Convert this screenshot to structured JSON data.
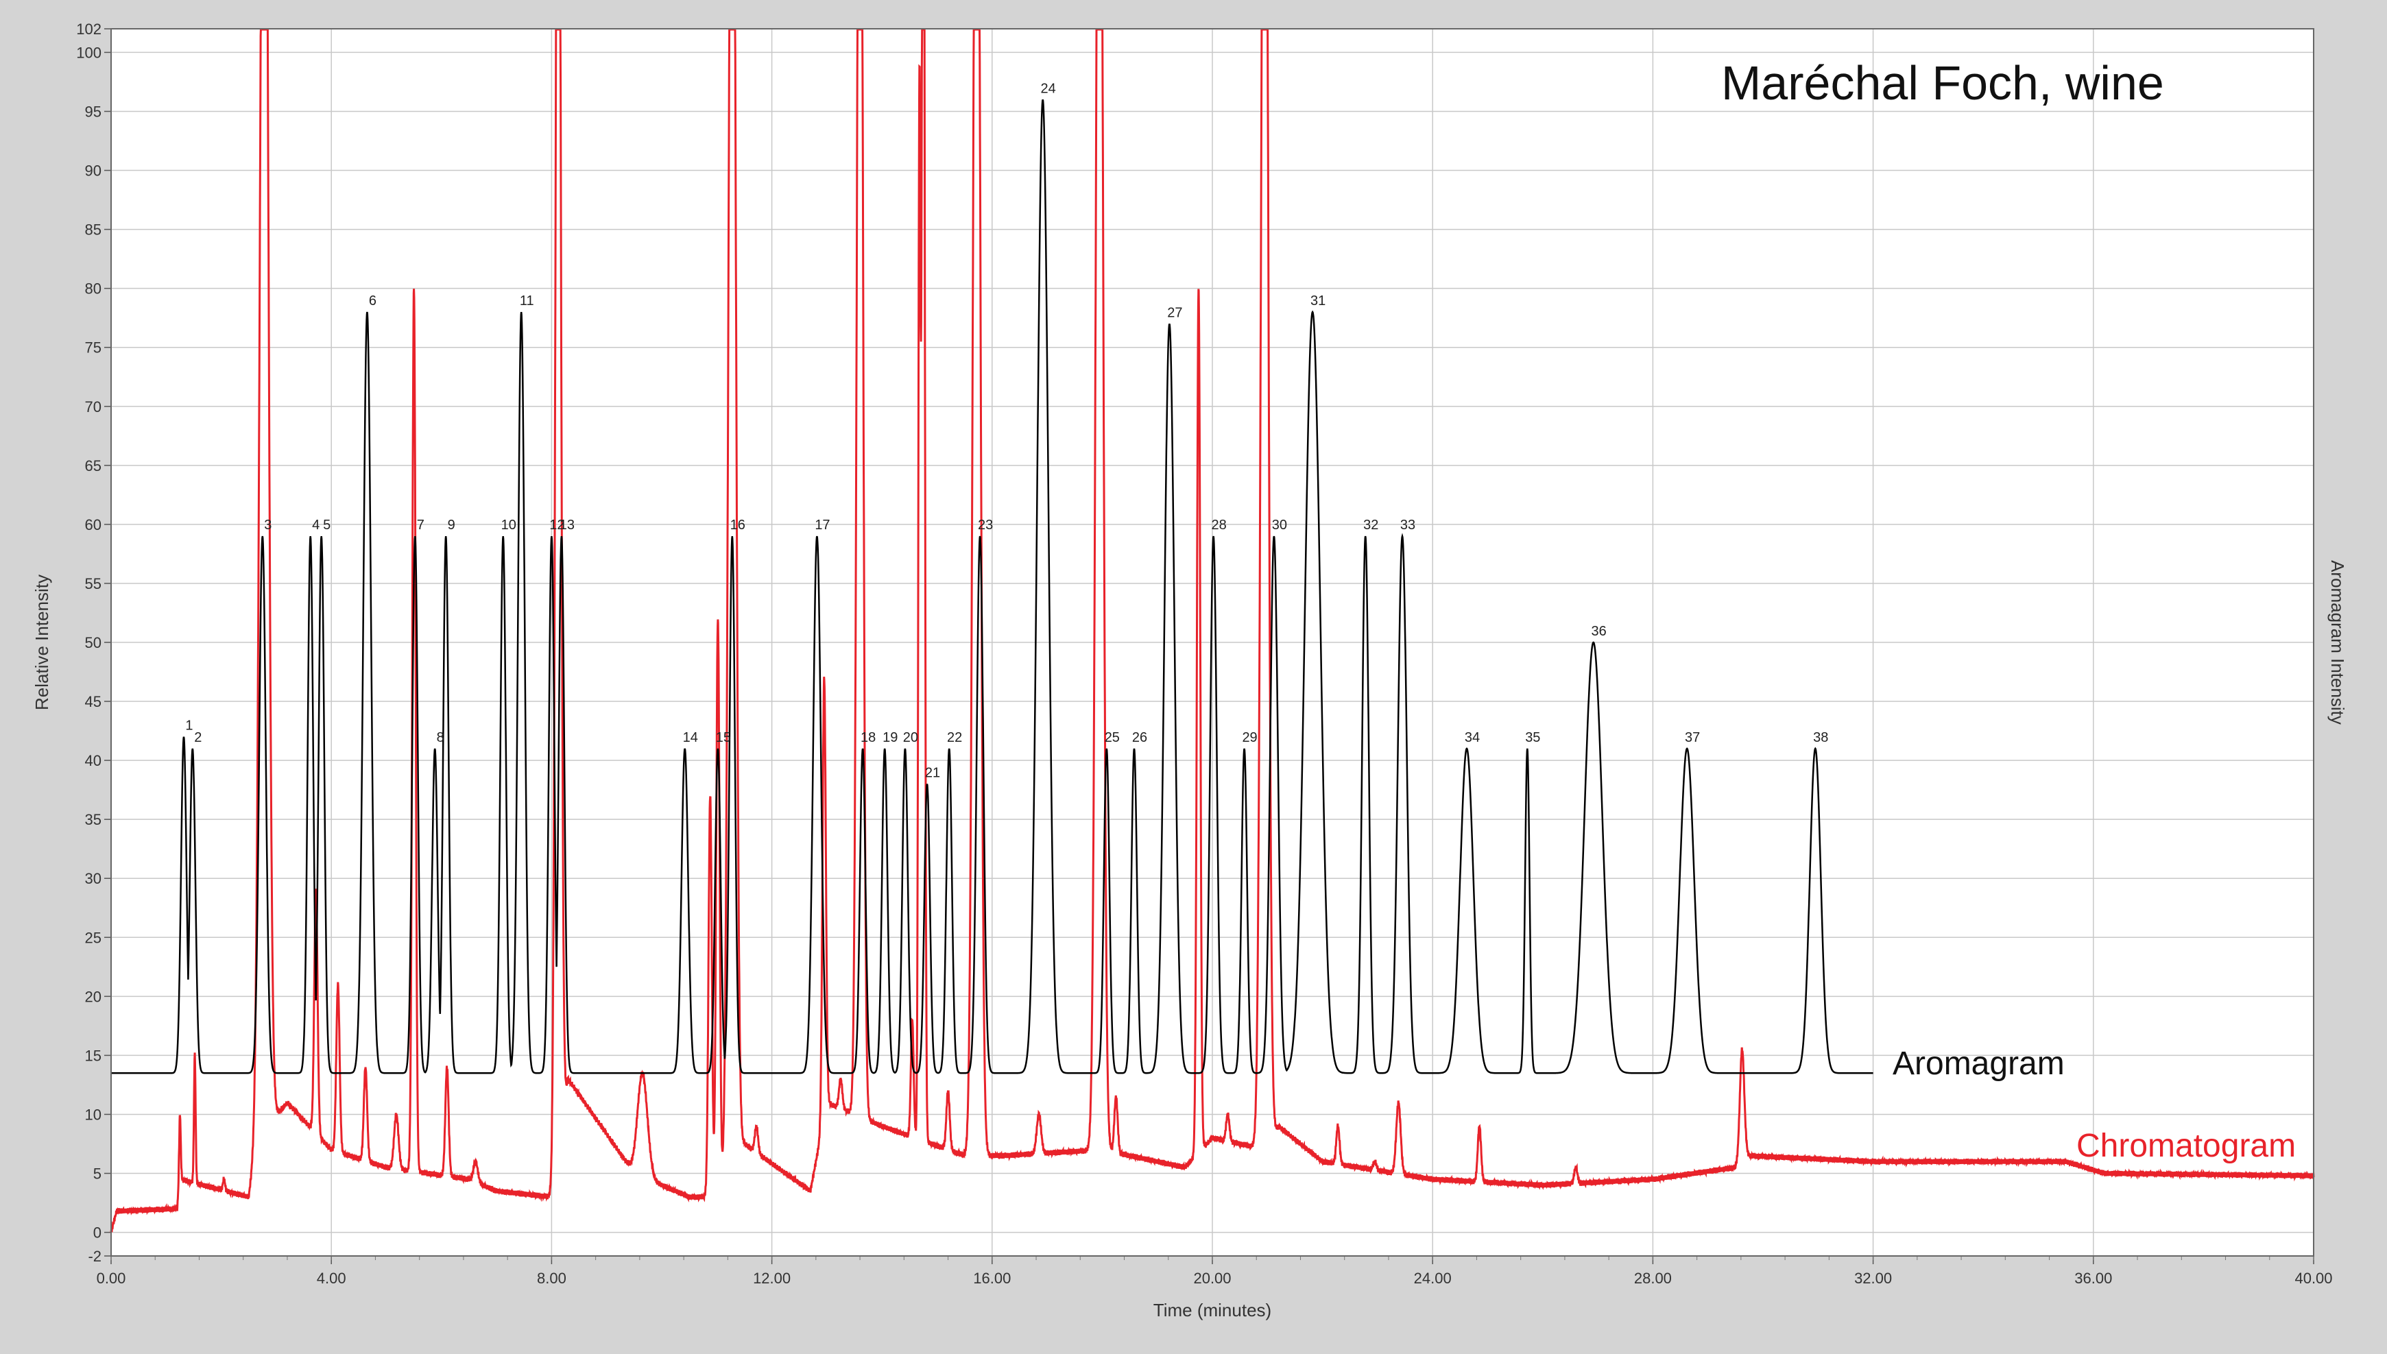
{
  "chart_data": {
    "type": "line",
    "title": "Maréchal Foch, wine",
    "xlabel": "Time (minutes)",
    "ylabel": "Relative Intensity",
    "y2label": "Aromagram Intensity",
    "xlim": [
      0,
      40
    ],
    "ylim": [
      -2,
      102
    ],
    "x_ticks": [
      "0.00",
      "4.00",
      "8.00",
      "12.00",
      "16.00",
      "20.00",
      "24.00",
      "28.00",
      "32.00",
      "36.00",
      "40.00"
    ],
    "y_ticks": [
      "-2",
      "0",
      "5",
      "10",
      "15",
      "20",
      "25",
      "30",
      "35",
      "40",
      "45",
      "50",
      "55",
      "60",
      "65",
      "70",
      "75",
      "80",
      "85",
      "90",
      "95",
      "100",
      "102"
    ],
    "grid": true,
    "colors": {
      "aromagram": "#000000",
      "chromatogram": "#e8222a",
      "plot_bg": "#ffffff",
      "frame_bg": "#d4d4d4",
      "grid": "#c8c8c8"
    },
    "series": [
      {
        "name": "Aromagram",
        "baseline": 13.5,
        "end_x": 32.0,
        "peaks": [
          {
            "label": "1",
            "x": 1.32,
            "y": 42,
            "w": 0.05
          },
          {
            "label": "2",
            "x": 1.48,
            "y": 41,
            "w": 0.05
          },
          {
            "label": "3",
            "x": 2.75,
            "y": 59,
            "w": 0.06
          },
          {
            "label": "4",
            "x": 3.62,
            "y": 59,
            "w": 0.05
          },
          {
            "label": "5",
            "x": 3.82,
            "y": 59,
            "w": 0.05
          },
          {
            "label": "6",
            "x": 4.65,
            "y": 78,
            "w": 0.07
          },
          {
            "label": "7",
            "x": 5.52,
            "y": 59,
            "w": 0.05
          },
          {
            "label": "8",
            "x": 5.88,
            "y": 41,
            "w": 0.05
          },
          {
            "label": "9",
            "x": 6.08,
            "y": 59,
            "w": 0.05
          },
          {
            "label": "10",
            "x": 7.12,
            "y": 59,
            "w": 0.05
          },
          {
            "label": "11",
            "x": 7.45,
            "y": 78,
            "w": 0.06
          },
          {
            "label": "12",
            "x": 8.0,
            "y": 59,
            "w": 0.05
          },
          {
            "label": "13",
            "x": 8.18,
            "y": 59,
            "w": 0.05
          },
          {
            "label": "14",
            "x": 10.42,
            "y": 41,
            "w": 0.06
          },
          {
            "label": "15",
            "x": 11.02,
            "y": 41,
            "w": 0.05
          },
          {
            "label": "16",
            "x": 11.28,
            "y": 59,
            "w": 0.05
          },
          {
            "label": "17",
            "x": 12.82,
            "y": 59,
            "w": 0.07
          },
          {
            "label": "18",
            "x": 13.65,
            "y": 41,
            "w": 0.05
          },
          {
            "label": "19",
            "x": 14.05,
            "y": 41,
            "w": 0.05
          },
          {
            "label": "20",
            "x": 14.42,
            "y": 41,
            "w": 0.05
          },
          {
            "label": "21",
            "x": 14.82,
            "y": 38,
            "w": 0.05
          },
          {
            "label": "22",
            "x": 15.22,
            "y": 41,
            "w": 0.05
          },
          {
            "label": "23",
            "x": 15.78,
            "y": 59,
            "w": 0.06
          },
          {
            "label": "24",
            "x": 16.92,
            "y": 96,
            "w": 0.1
          },
          {
            "label": "25",
            "x": 18.08,
            "y": 41,
            "w": 0.05
          },
          {
            "label": "26",
            "x": 18.58,
            "y": 41,
            "w": 0.05
          },
          {
            "label": "27",
            "x": 19.22,
            "y": 77,
            "w": 0.09
          },
          {
            "label": "28",
            "x": 20.02,
            "y": 59,
            "w": 0.06
          },
          {
            "label": "29",
            "x": 20.58,
            "y": 41,
            "w": 0.05
          },
          {
            "label": "30",
            "x": 21.12,
            "y": 59,
            "w": 0.07
          },
          {
            "label": "31",
            "x": 21.82,
            "y": 78,
            "w": 0.14
          },
          {
            "label": "32",
            "x": 22.78,
            "y": 59,
            "w": 0.06
          },
          {
            "label": "33",
            "x": 23.45,
            "y": 59,
            "w": 0.08
          },
          {
            "label": "34",
            "x": 24.62,
            "y": 41,
            "w": 0.12
          },
          {
            "label": "35",
            "x": 25.72,
            "y": 41,
            "w": 0.04
          },
          {
            "label": "36",
            "x": 26.92,
            "y": 50,
            "w": 0.16
          },
          {
            "label": "37",
            "x": 28.62,
            "y": 41,
            "w": 0.13
          },
          {
            "label": "38",
            "x": 30.95,
            "y": 41,
            "w": 0.1
          }
        ]
      },
      {
        "name": "Chromatogram",
        "baseline_profile": [
          [
            0.0,
            0.0
          ],
          [
            0.1,
            1.8
          ],
          [
            1.2,
            2.0
          ],
          [
            1.25,
            4.5
          ],
          [
            2.5,
            3.0
          ],
          [
            2.65,
            8.0
          ],
          [
            3.2,
            11.0
          ],
          [
            4.0,
            7.0
          ],
          [
            5.0,
            5.5
          ],
          [
            6.5,
            4.5
          ],
          [
            7.0,
            3.5
          ],
          [
            8.0,
            3.0
          ],
          [
            8.3,
            13.0
          ],
          [
            9.5,
            5.0
          ],
          [
            10.5,
            3.0
          ],
          [
            11.0,
            3.0
          ],
          [
            11.5,
            7.5
          ],
          [
            12.7,
            3.5
          ],
          [
            13.0,
            11.0
          ],
          [
            14.0,
            9.0
          ],
          [
            15.5,
            6.5
          ],
          [
            16.2,
            6.5
          ],
          [
            18.0,
            7.0
          ],
          [
            19.5,
            5.5
          ],
          [
            20.0,
            8.0
          ],
          [
            21.0,
            7.0
          ],
          [
            21.2,
            9.0
          ],
          [
            22.0,
            6.0
          ],
          [
            24.0,
            4.5
          ],
          [
            26.0,
            4.0
          ],
          [
            28.0,
            4.5
          ],
          [
            29.5,
            5.5
          ],
          [
            29.7,
            6.5
          ],
          [
            32.0,
            6.0
          ],
          [
            35.5,
            6.0
          ],
          [
            36.2,
            5.0
          ],
          [
            40.0,
            4.8
          ]
        ],
        "peaks": [
          {
            "x": 1.25,
            "y": 10,
            "w": 0.015
          },
          {
            "x": 1.52,
            "y": 15,
            "w": 0.015
          },
          {
            "x": 2.05,
            "y": 4.5,
            "w": 0.02
          },
          {
            "x": 2.78,
            "y": 150,
            "w": 0.07
          },
          {
            "x": 3.72,
            "y": 29,
            "w": 0.03
          },
          {
            "x": 4.12,
            "y": 21,
            "w": 0.03
          },
          {
            "x": 4.62,
            "y": 14,
            "w": 0.03
          },
          {
            "x": 5.18,
            "y": 10,
            "w": 0.04
          },
          {
            "x": 5.5,
            "y": 80,
            "w": 0.03
          },
          {
            "x": 6.1,
            "y": 14,
            "w": 0.03
          },
          {
            "x": 6.62,
            "y": 6,
            "w": 0.04
          },
          {
            "x": 8.12,
            "y": 150,
            "w": 0.045
          },
          {
            "x": 9.65,
            "y": 13.5,
            "w": 0.09
          },
          {
            "x": 10.88,
            "y": 37,
            "w": 0.03
          },
          {
            "x": 11.02,
            "y": 52,
            "w": 0.03
          },
          {
            "x": 11.28,
            "y": 150,
            "w": 0.06
          },
          {
            "x": 11.72,
            "y": 9,
            "w": 0.03
          },
          {
            "x": 12.95,
            "y": 47,
            "w": 0.03
          },
          {
            "x": 13.25,
            "y": 13,
            "w": 0.03
          },
          {
            "x": 13.6,
            "y": 150,
            "w": 0.05
          },
          {
            "x": 14.55,
            "y": 18,
            "w": 0.025
          },
          {
            "x": 14.68,
            "y": 96,
            "w": 0.02
          },
          {
            "x": 14.75,
            "y": 150,
            "w": 0.025
          },
          {
            "x": 15.2,
            "y": 12,
            "w": 0.03
          },
          {
            "x": 15.72,
            "y": 150,
            "w": 0.06
          },
          {
            "x": 16.85,
            "y": 10,
            "w": 0.04
          },
          {
            "x": 17.95,
            "y": 150,
            "w": 0.06
          },
          {
            "x": 18.25,
            "y": 11.5,
            "w": 0.03
          },
          {
            "x": 19.75,
            "y": 80,
            "w": 0.03
          },
          {
            "x": 20.28,
            "y": 10,
            "w": 0.03
          },
          {
            "x": 20.95,
            "y": 150,
            "w": 0.06
          },
          {
            "x": 22.28,
            "y": 9,
            "w": 0.03
          },
          {
            "x": 22.95,
            "y": 6,
            "w": 0.03
          },
          {
            "x": 23.38,
            "y": 11,
            "w": 0.04
          },
          {
            "x": 24.85,
            "y": 9,
            "w": 0.03
          },
          {
            "x": 26.6,
            "y": 5.5,
            "w": 0.03
          },
          {
            "x": 29.62,
            "y": 15.5,
            "w": 0.04
          }
        ]
      }
    ]
  }
}
